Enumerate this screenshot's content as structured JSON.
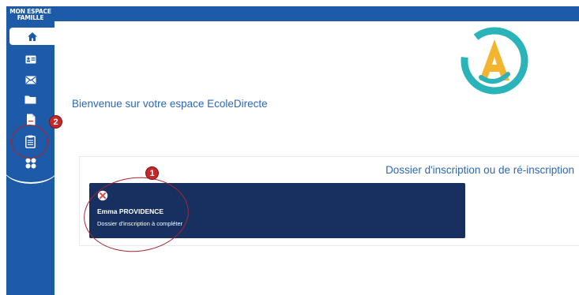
{
  "sidebar": {
    "brand_line1": "MON ESPACE",
    "brand_line2": "FAMILLE",
    "items": [
      {
        "icon": "home-icon"
      },
      {
        "icon": "id-card-icon"
      },
      {
        "icon": "envelope-icon"
      },
      {
        "icon": "folder-icon"
      },
      {
        "icon": "document-icon"
      },
      {
        "icon": "clipboard-icon"
      },
      {
        "icon": "puzzle-icon"
      }
    ]
  },
  "main": {
    "welcome": "Bienvenue sur votre espace EcoleDirecte",
    "panel_title": "Dossier d'inscription ou de ré-inscription",
    "card": {
      "student_name": "Emma PROVIDENCE",
      "status": "Dossier d'inscription à compléter",
      "status_icon": "incomplete-icon"
    }
  },
  "annotations": {
    "badge1": "1",
    "badge2": "2",
    "color": "#c52828"
  },
  "colors": {
    "sidebar": "#1d5ba8",
    "card": "#17305f",
    "title_text": "#2d68b5"
  }
}
